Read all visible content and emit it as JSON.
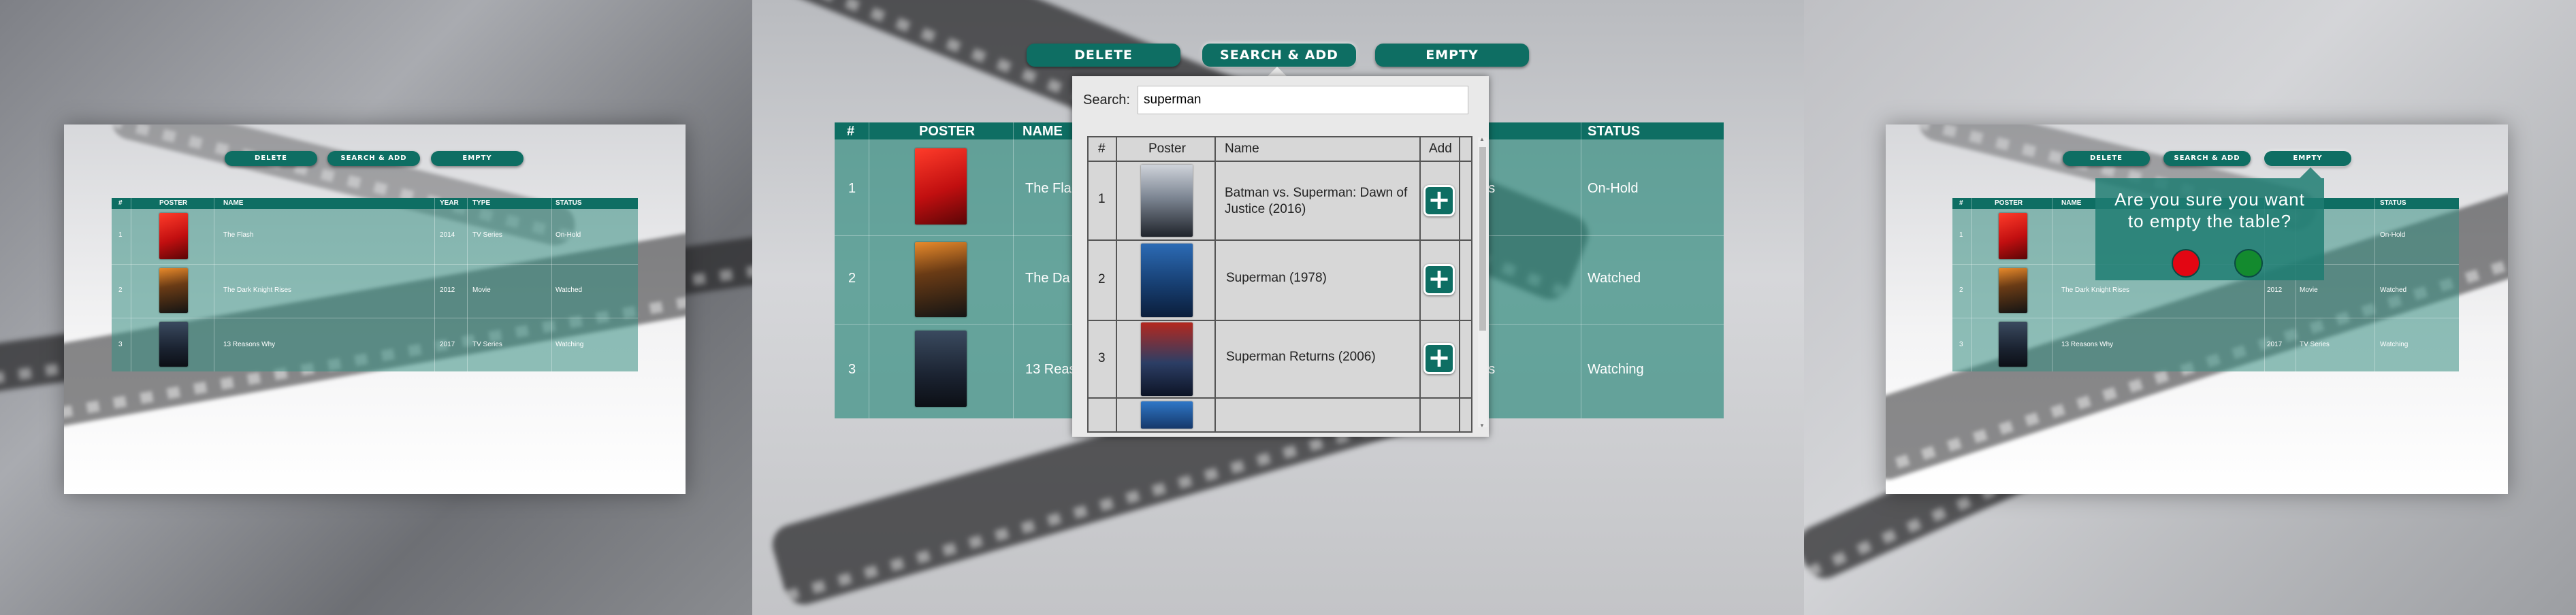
{
  "buttons": {
    "delete": "DELETE",
    "search_add": "SEARCH & ADD",
    "empty": "EMPTY"
  },
  "table": {
    "headers_full": [
      "#",
      "POSTER",
      "NAME",
      "YEAR",
      "TYPE",
      "STATUS"
    ],
    "headers_mid": [
      "#",
      "POSTER",
      "NAME",
      "STATUS"
    ],
    "rows": [
      {
        "num": "1",
        "name": "The Flash",
        "year": "2014",
        "type": "TV Series",
        "status": "On-Hold"
      },
      {
        "num": "2",
        "name": "The Dark Knight Rises",
        "year": "2012",
        "type": "Movie",
        "status": "Watched"
      },
      {
        "num": "3",
        "name": "13 Reasons Why",
        "year": "2017",
        "type": "TV Series",
        "status": "Watching"
      }
    ],
    "mid_partial_names": [
      "The Fla",
      "The Da",
      "13 Reas"
    ],
    "mid_partial_types": [
      "ries",
      "",
      "ries"
    ]
  },
  "search": {
    "label": "Search:",
    "value": "superman",
    "headers": [
      "#",
      "Poster",
      "Name",
      "Add"
    ],
    "results": [
      {
        "num": "1",
        "name": "Batman vs. Superman: Dawn of Justice (2016)",
        "add": "+"
      },
      {
        "num": "2",
        "name": "Superman (1978)",
        "add": "+"
      },
      {
        "num": "3",
        "name": "Superman Returns (2006)",
        "add": "+"
      }
    ],
    "scroll_up": "▲",
    "scroll_down": "▼"
  },
  "confirm": {
    "line1": "Are you sure you want",
    "line2": "to empty the table?",
    "cancel_color": "#e30613",
    "confirm_color": "#138a2e"
  },
  "colors": {
    "accent": "#0e6e63",
    "table_fill": "#368e82"
  }
}
